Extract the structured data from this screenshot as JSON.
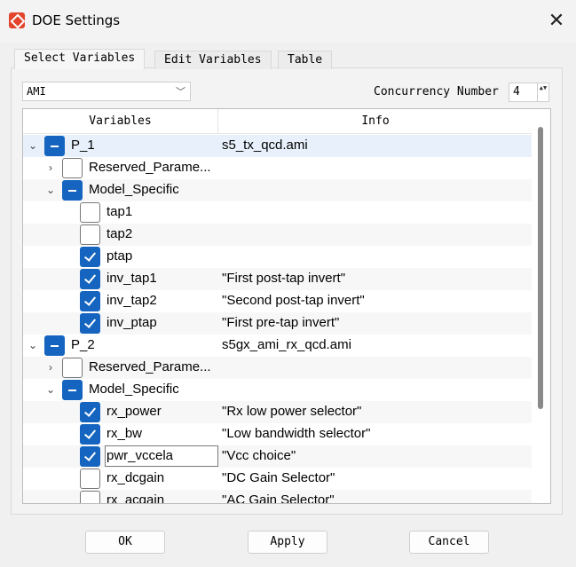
{
  "window": {
    "title": "DOE Settings",
    "close_glyph": "✕"
  },
  "tabs": [
    {
      "label": "Select Variables"
    },
    {
      "label": "Edit Variables"
    },
    {
      "label": "Table"
    }
  ],
  "model_select": {
    "value": "AMI",
    "chevron": "﹀"
  },
  "concurrency": {
    "label": "Concurrency Number",
    "value": "4",
    "arrows": "▲▼"
  },
  "tree": {
    "columns": [
      "Variables",
      "Info"
    ],
    "rows": [
      {
        "label": "P_1",
        "info": "s5_tx_qcd.ami",
        "state": "partial",
        "expander": "⌄"
      },
      {
        "label": "Reserved_Parame...",
        "info": "",
        "state": "unchecked",
        "expander": "›"
      },
      {
        "label": "Model_Specific",
        "info": "",
        "state": "partial",
        "expander": "⌄"
      },
      {
        "label": "tap1",
        "info": "",
        "state": "unchecked",
        "expander": ""
      },
      {
        "label": "tap2",
        "info": "",
        "state": "unchecked",
        "expander": ""
      },
      {
        "label": "ptap",
        "info": "",
        "state": "checked",
        "expander": ""
      },
      {
        "label": "inv_tap1",
        "info": "\"First post-tap invert\"",
        "state": "checked",
        "expander": ""
      },
      {
        "label": "inv_tap2",
        "info": "\"Second post-tap invert\"",
        "state": "checked",
        "expander": ""
      },
      {
        "label": "inv_ptap",
        "info": "\"First pre-tap invert\"",
        "state": "checked",
        "expander": ""
      },
      {
        "label": "P_2",
        "info": "s5gx_ami_rx_qcd.ami",
        "state": "partial",
        "expander": "⌄"
      },
      {
        "label": "Reserved_Parame...",
        "info": "",
        "state": "unchecked",
        "expander": "›"
      },
      {
        "label": "Model_Specific",
        "info": "",
        "state": "partial",
        "expander": "⌄"
      },
      {
        "label": "rx_power",
        "info": "\"Rx low power selector\"",
        "state": "checked",
        "expander": ""
      },
      {
        "label": "rx_bw",
        "info": "\"Low bandwidth selector\"",
        "state": "checked",
        "expander": ""
      },
      {
        "label": "pwr_vccela",
        "info": "\"Vcc choice\"",
        "state": "checked",
        "expander": ""
      },
      {
        "label": "rx_dcgain",
        "info": "\"DC Gain Selector\"",
        "state": "unchecked",
        "expander": ""
      },
      {
        "label": "rx_acgain",
        "info": "\"AC Gain Selector\"",
        "state": "unchecked",
        "expander": ""
      }
    ]
  },
  "buttons": {
    "ok": "OK",
    "apply": "Apply",
    "cancel": "Cancel"
  }
}
